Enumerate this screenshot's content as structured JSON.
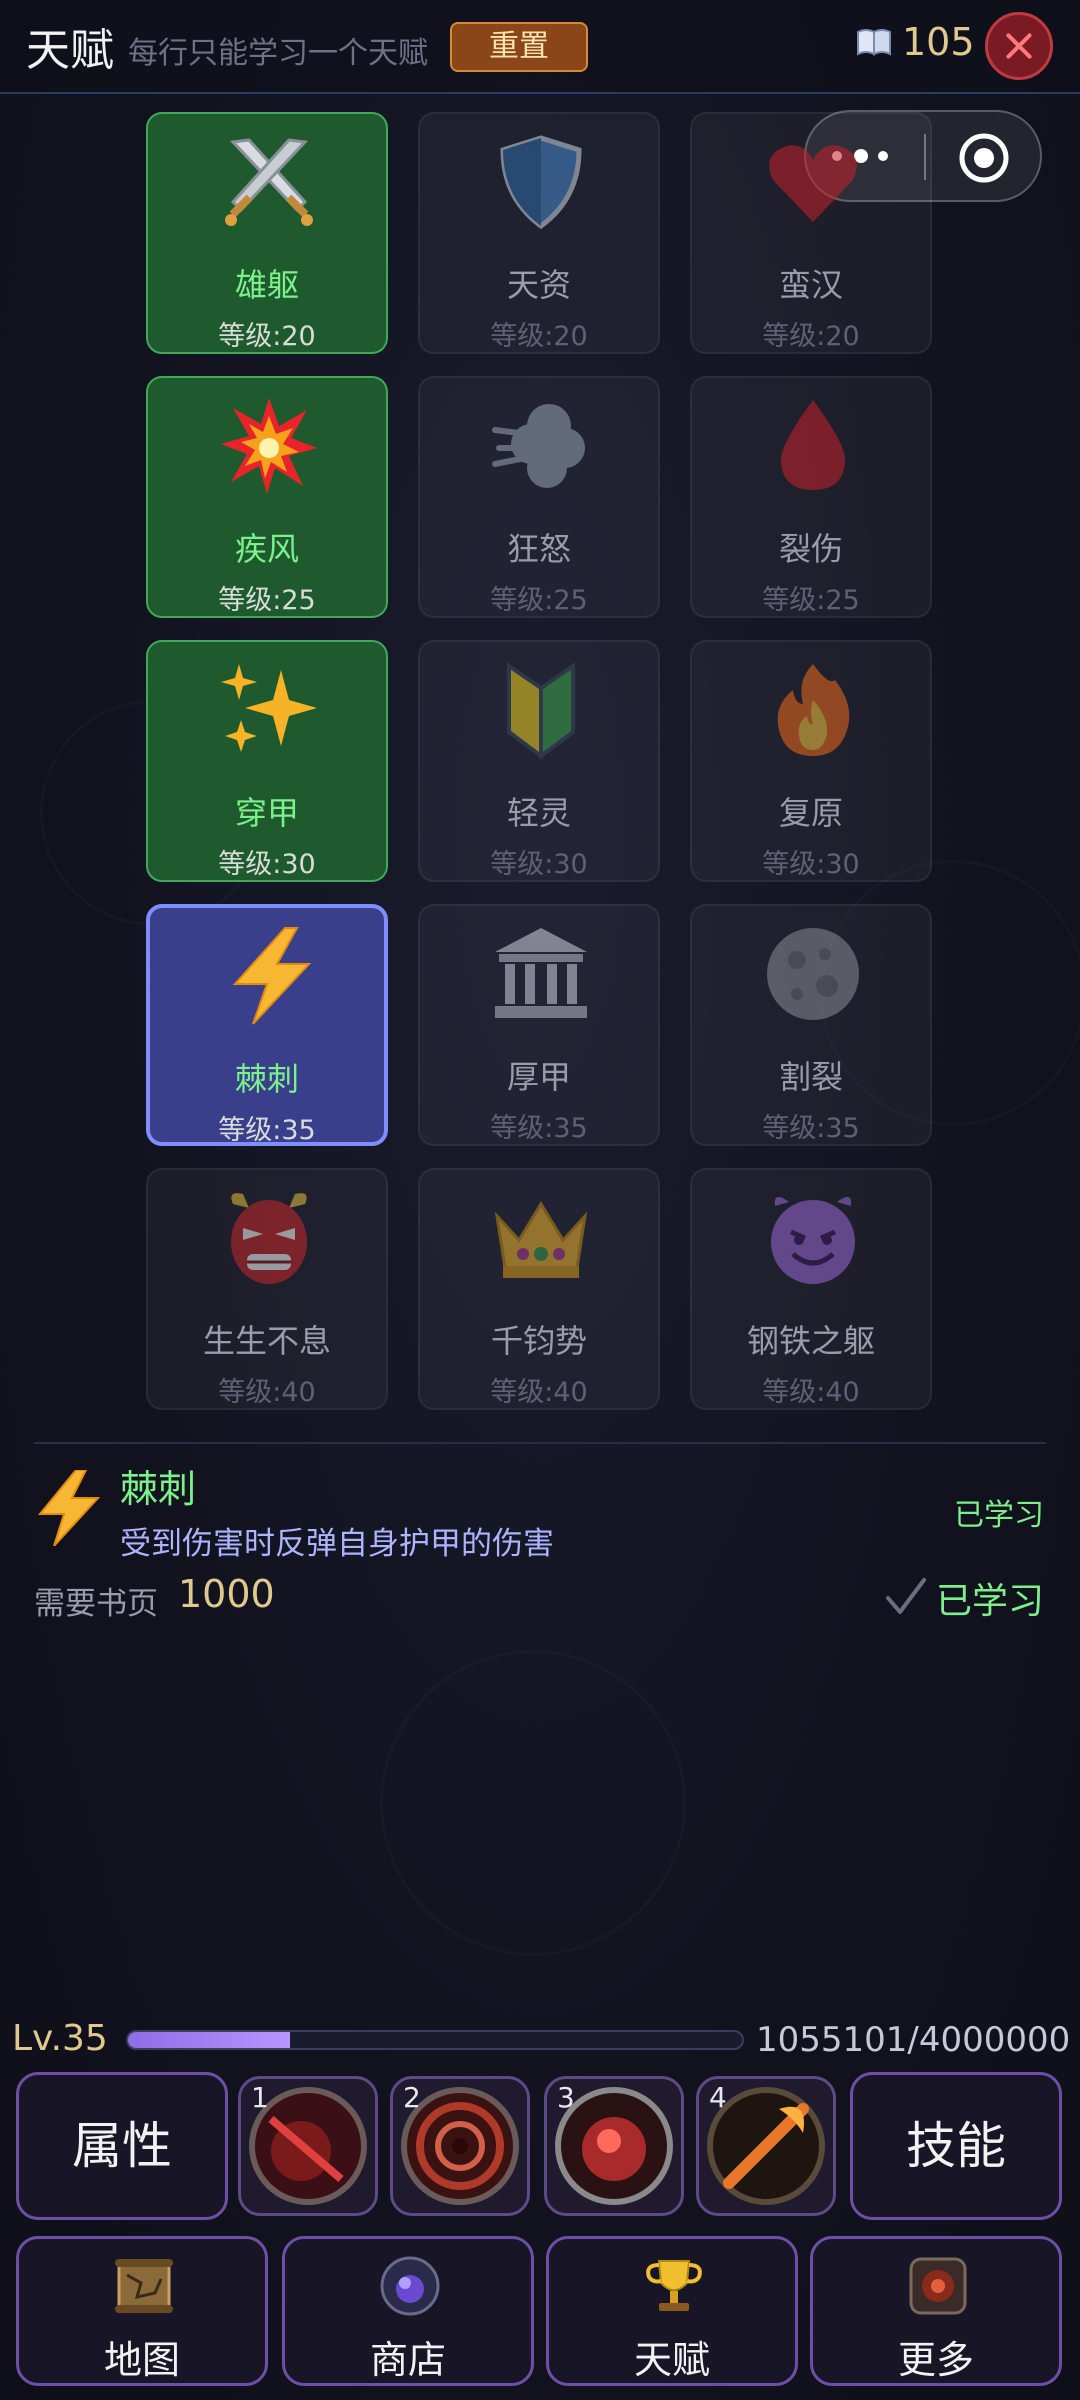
{
  "header": {
    "title": "天赋",
    "subtitle": "每行只能学习一个天赋",
    "reset_label": "重置",
    "book_count": "105"
  },
  "talents": [
    {
      "name": "雄躯",
      "level": "等级:20",
      "icon": "crossed-swords-icon",
      "state": "learned"
    },
    {
      "name": "天资",
      "level": "等级:20",
      "icon": "shield-icon",
      "state": "locked"
    },
    {
      "name": "蛮汉",
      "level": "等级:20",
      "icon": "heart-icon",
      "state": "locked"
    },
    {
      "name": "疾风",
      "level": "等级:25",
      "icon": "explosion-icon",
      "state": "learned"
    },
    {
      "name": "狂怒",
      "level": "等级:25",
      "icon": "wind-icon",
      "state": "locked"
    },
    {
      "name": "裂伤",
      "level": "等级:25",
      "icon": "blood-drop-icon",
      "state": "locked"
    },
    {
      "name": "穿甲",
      "level": "等级:30",
      "icon": "sparkles-icon",
      "state": "learned"
    },
    {
      "name": "轻灵",
      "level": "等级:30",
      "icon": "beginner-leaf-icon",
      "state": "locked"
    },
    {
      "name": "复原",
      "level": "等级:30",
      "icon": "fire-icon",
      "state": "locked"
    },
    {
      "name": "棘刺",
      "level": "等级:35",
      "icon": "lightning-icon",
      "state": "selected"
    },
    {
      "name": "厚甲",
      "level": "等级:35",
      "icon": "classical-building-icon",
      "state": "locked"
    },
    {
      "name": "割裂",
      "level": "等级:35",
      "icon": "moon-icon",
      "state": "locked"
    },
    {
      "name": "生生不息",
      "level": "等级:40",
      "icon": "ogre-mask-icon",
      "state": "locked"
    },
    {
      "name": "千钧势",
      "level": "等级:40",
      "icon": "crown-icon",
      "state": "locked"
    },
    {
      "name": "钢铁之躯",
      "level": "等级:40",
      "icon": "devil-face-icon",
      "state": "locked"
    }
  ],
  "detail": {
    "name": "棘刺",
    "description": "受到伤害时反弹自身护甲的伤害",
    "status": "已学习",
    "cost_label": "需要书页",
    "cost_value": "1000",
    "learned_label": "已学习",
    "icon": "lightning-icon"
  },
  "player": {
    "level_label": "Lv.35",
    "xp_text": "1055101/4000000",
    "xp_fraction": 0.264
  },
  "actions": {
    "attributes_label": "属性",
    "skills_label": "技能",
    "skill_slots": [
      "1",
      "2",
      "3",
      "4"
    ]
  },
  "nav": [
    {
      "label": "地图",
      "icon": "scroll-map-icon"
    },
    {
      "label": "商店",
      "icon": "magic-orb-icon"
    },
    {
      "label": "天赋",
      "icon": "trophy-icon"
    },
    {
      "label": "更多",
      "icon": "gear-box-icon"
    }
  ],
  "colors": {
    "learned_green": "#7cf08a",
    "selected_border": "#7f8dff",
    "gold": "#e0c98e",
    "accent_purple": "#6e4fa8"
  }
}
